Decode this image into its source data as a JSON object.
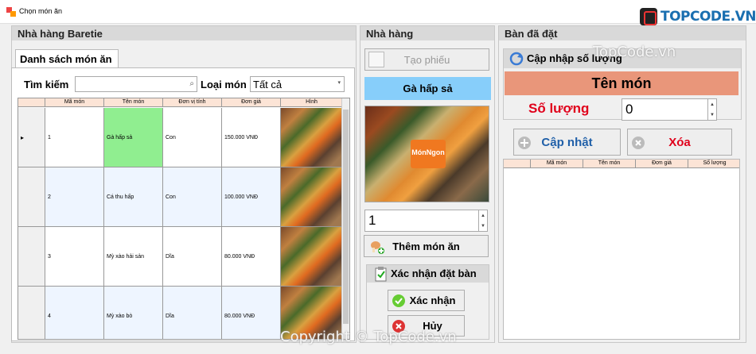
{
  "window": {
    "title": "Chọn món ăn"
  },
  "brand": {
    "logo_text": "TOPCODE.VN",
    "watermark_top": "TopCode.vn",
    "watermark_bottom": "Copyright © TopCode.vn"
  },
  "left_panel": {
    "header": "Nhà hàng Baretie",
    "tab": "Danh sách món ăn",
    "search_label": "Tìm kiếm",
    "search_value": "",
    "category_label": "Loại món",
    "category_value": "Tất cả",
    "columns": [
      "Mã món",
      "Tên món",
      "Đơn vị tính",
      "Đơn giá",
      "Hình"
    ],
    "rows": [
      {
        "id": "1",
        "name": "Gà hấp sả",
        "unit": "Con",
        "price": "150.000 VNĐ"
      },
      {
        "id": "2",
        "name": "Cá thu hấp",
        "unit": "Con",
        "price": "100.000 VNĐ"
      },
      {
        "id": "3",
        "name": "Mỳ xào hải sản",
        "unit": "Dĩa",
        "price": "80.000 VNĐ"
      },
      {
        "id": "4",
        "name": "Mỳ xào bò",
        "unit": "Dĩa",
        "price": "80.000 VNĐ"
      }
    ]
  },
  "middle_panel": {
    "header": "Nhà hàng",
    "create_ticket": "Tạo phiếu",
    "selected_dish": "Gà hấp sả",
    "image_badge": "MónNgon",
    "quantity": "1",
    "add_dish": "Thêm món ăn",
    "confirm_group": "Xác nhận đặt bàn",
    "confirm": "Xác nhận",
    "cancel": "Hủy"
  },
  "right_panel": {
    "header": "Bàn đã đặt",
    "update_group": "Cập nhập số lượng",
    "dish_name_label": "Tên món",
    "quantity_label": "Số lượng",
    "quantity_value": "0",
    "update_button": "Cập nhật",
    "delete_button": "Xóa",
    "columns": [
      "Mã món",
      "Tên món",
      "Đơn giá",
      "Số lượng"
    ]
  },
  "colors": {
    "selected_cell": "#90ee90",
    "highlight_bar": "#87cefa",
    "header_salmon": "#e9967a",
    "red_label": "#e0001b",
    "blue_text": "#1f5fa8"
  }
}
